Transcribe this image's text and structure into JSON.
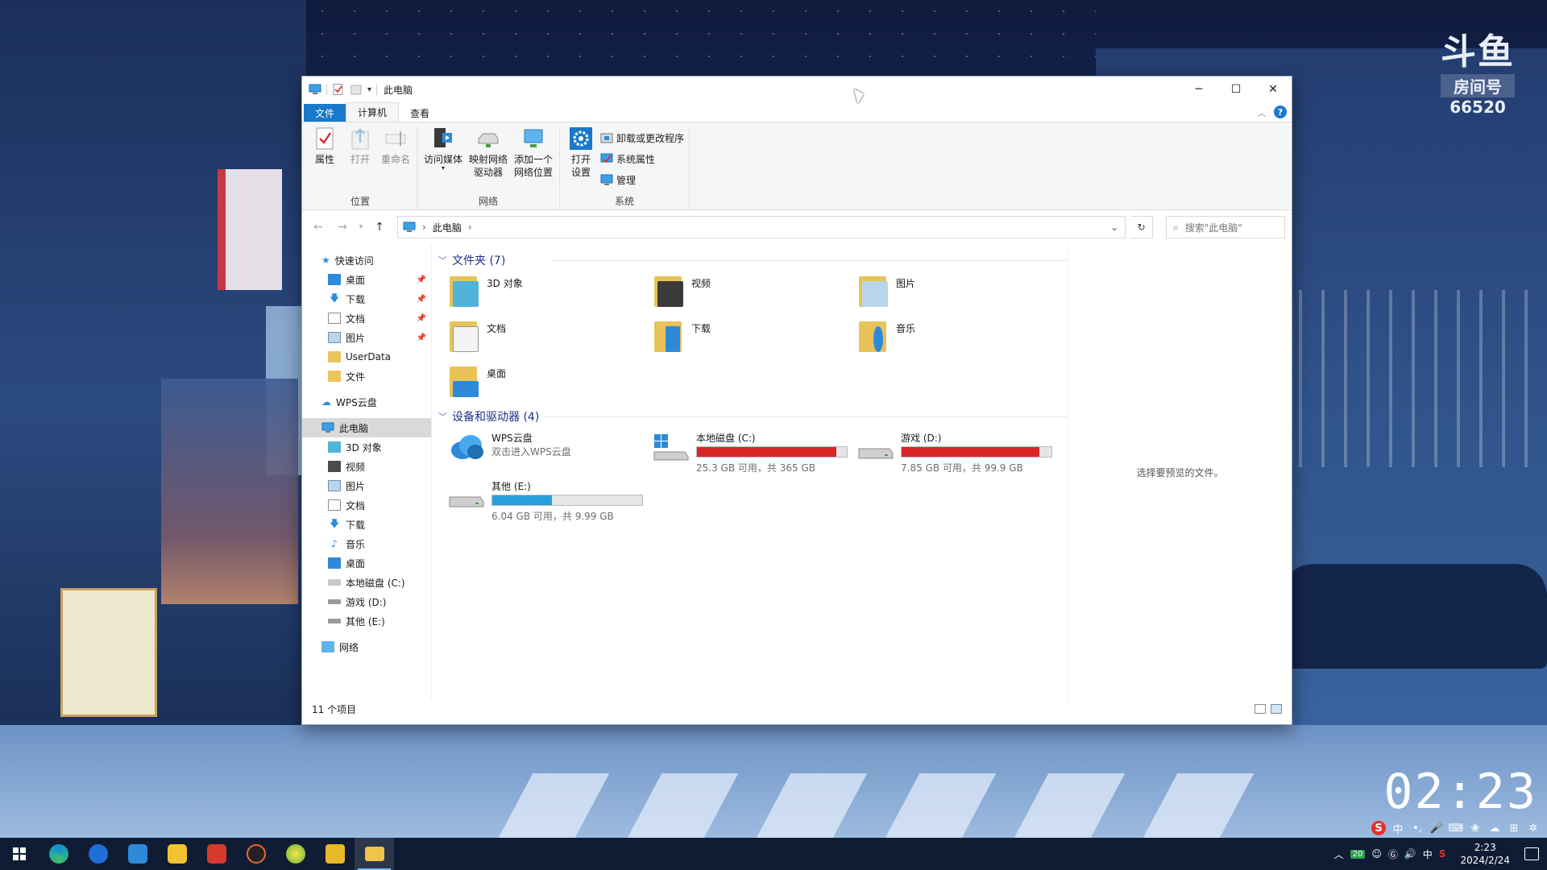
{
  "wallpaper": {
    "watermark_logo": "斗鱼",
    "watermark_tag": "房间号",
    "watermark_room": "66520",
    "clock": "02:23"
  },
  "window": {
    "title": "此电脑",
    "controls": {
      "minimize": "─",
      "maximize": "☐",
      "close": "✕"
    }
  },
  "ribbon": {
    "tabs": [
      "文件",
      "计算机",
      "查看"
    ],
    "groups": {
      "location": {
        "label": "位置",
        "buttons": [
          "属性",
          "打开",
          "重命名"
        ]
      },
      "network": {
        "label": "网络",
        "buttons": [
          "访问媒体",
          "映射网络驱动器",
          "添加一个网络位置"
        ],
        "map_line1": "映射网络",
        "map_line2": "驱动器",
        "add_line1": "添加一个",
        "add_line2": "网络位置"
      },
      "system": {
        "label": "系统",
        "open_line1": "打开",
        "open_line2": "设置",
        "small": [
          "卸载或更改程序",
          "系统属性",
          "管理"
        ]
      }
    }
  },
  "address": {
    "crumb": "此电脑",
    "search_placeholder": "搜索\"此电脑\""
  },
  "navpane": {
    "quick_access": "快速访问",
    "quick_items": [
      "桌面",
      "下载",
      "文档",
      "图片",
      "UserData",
      "文件"
    ],
    "wps": "WPS云盘",
    "this_pc": "此电脑",
    "pc_items": [
      "3D 对象",
      "视频",
      "图片",
      "文档",
      "下载",
      "音乐",
      "桌面",
      "本地磁盘 (C:)",
      "游戏 (D:)",
      "其他 (E:)"
    ],
    "network": "网络"
  },
  "content": {
    "folders_header": "文件夹 (7)",
    "folders": [
      "3D 对象",
      "视频",
      "图片",
      "文档",
      "下载",
      "音乐",
      "桌面"
    ],
    "drives_header": "设备和驱动器 (4)",
    "wps": {
      "name": "WPS云盘",
      "sub": "双击进入WPS云盘"
    },
    "drives": [
      {
        "name": "本地磁盘 (C:)",
        "free": "25.3 GB 可用，共 365 GB",
        "used_fraction": 0.93,
        "color": "#da2626"
      },
      {
        "name": "游戏 (D:)",
        "free": "7.85 GB 可用，共 99.9 GB",
        "used_fraction": 0.92,
        "color": "#da2626"
      },
      {
        "name": "其他 (E:)",
        "free": "6.04 GB 可用，共 9.99 GB",
        "used_fraction": 0.4,
        "color": "#26a0da"
      }
    ]
  },
  "preview": {
    "text": "选择要预览的文件。"
  },
  "status": {
    "count": "11 个项目"
  },
  "taskbar": {
    "time": "2:23",
    "date": "2024/2/24",
    "ime": "中",
    "badge": "20"
  }
}
